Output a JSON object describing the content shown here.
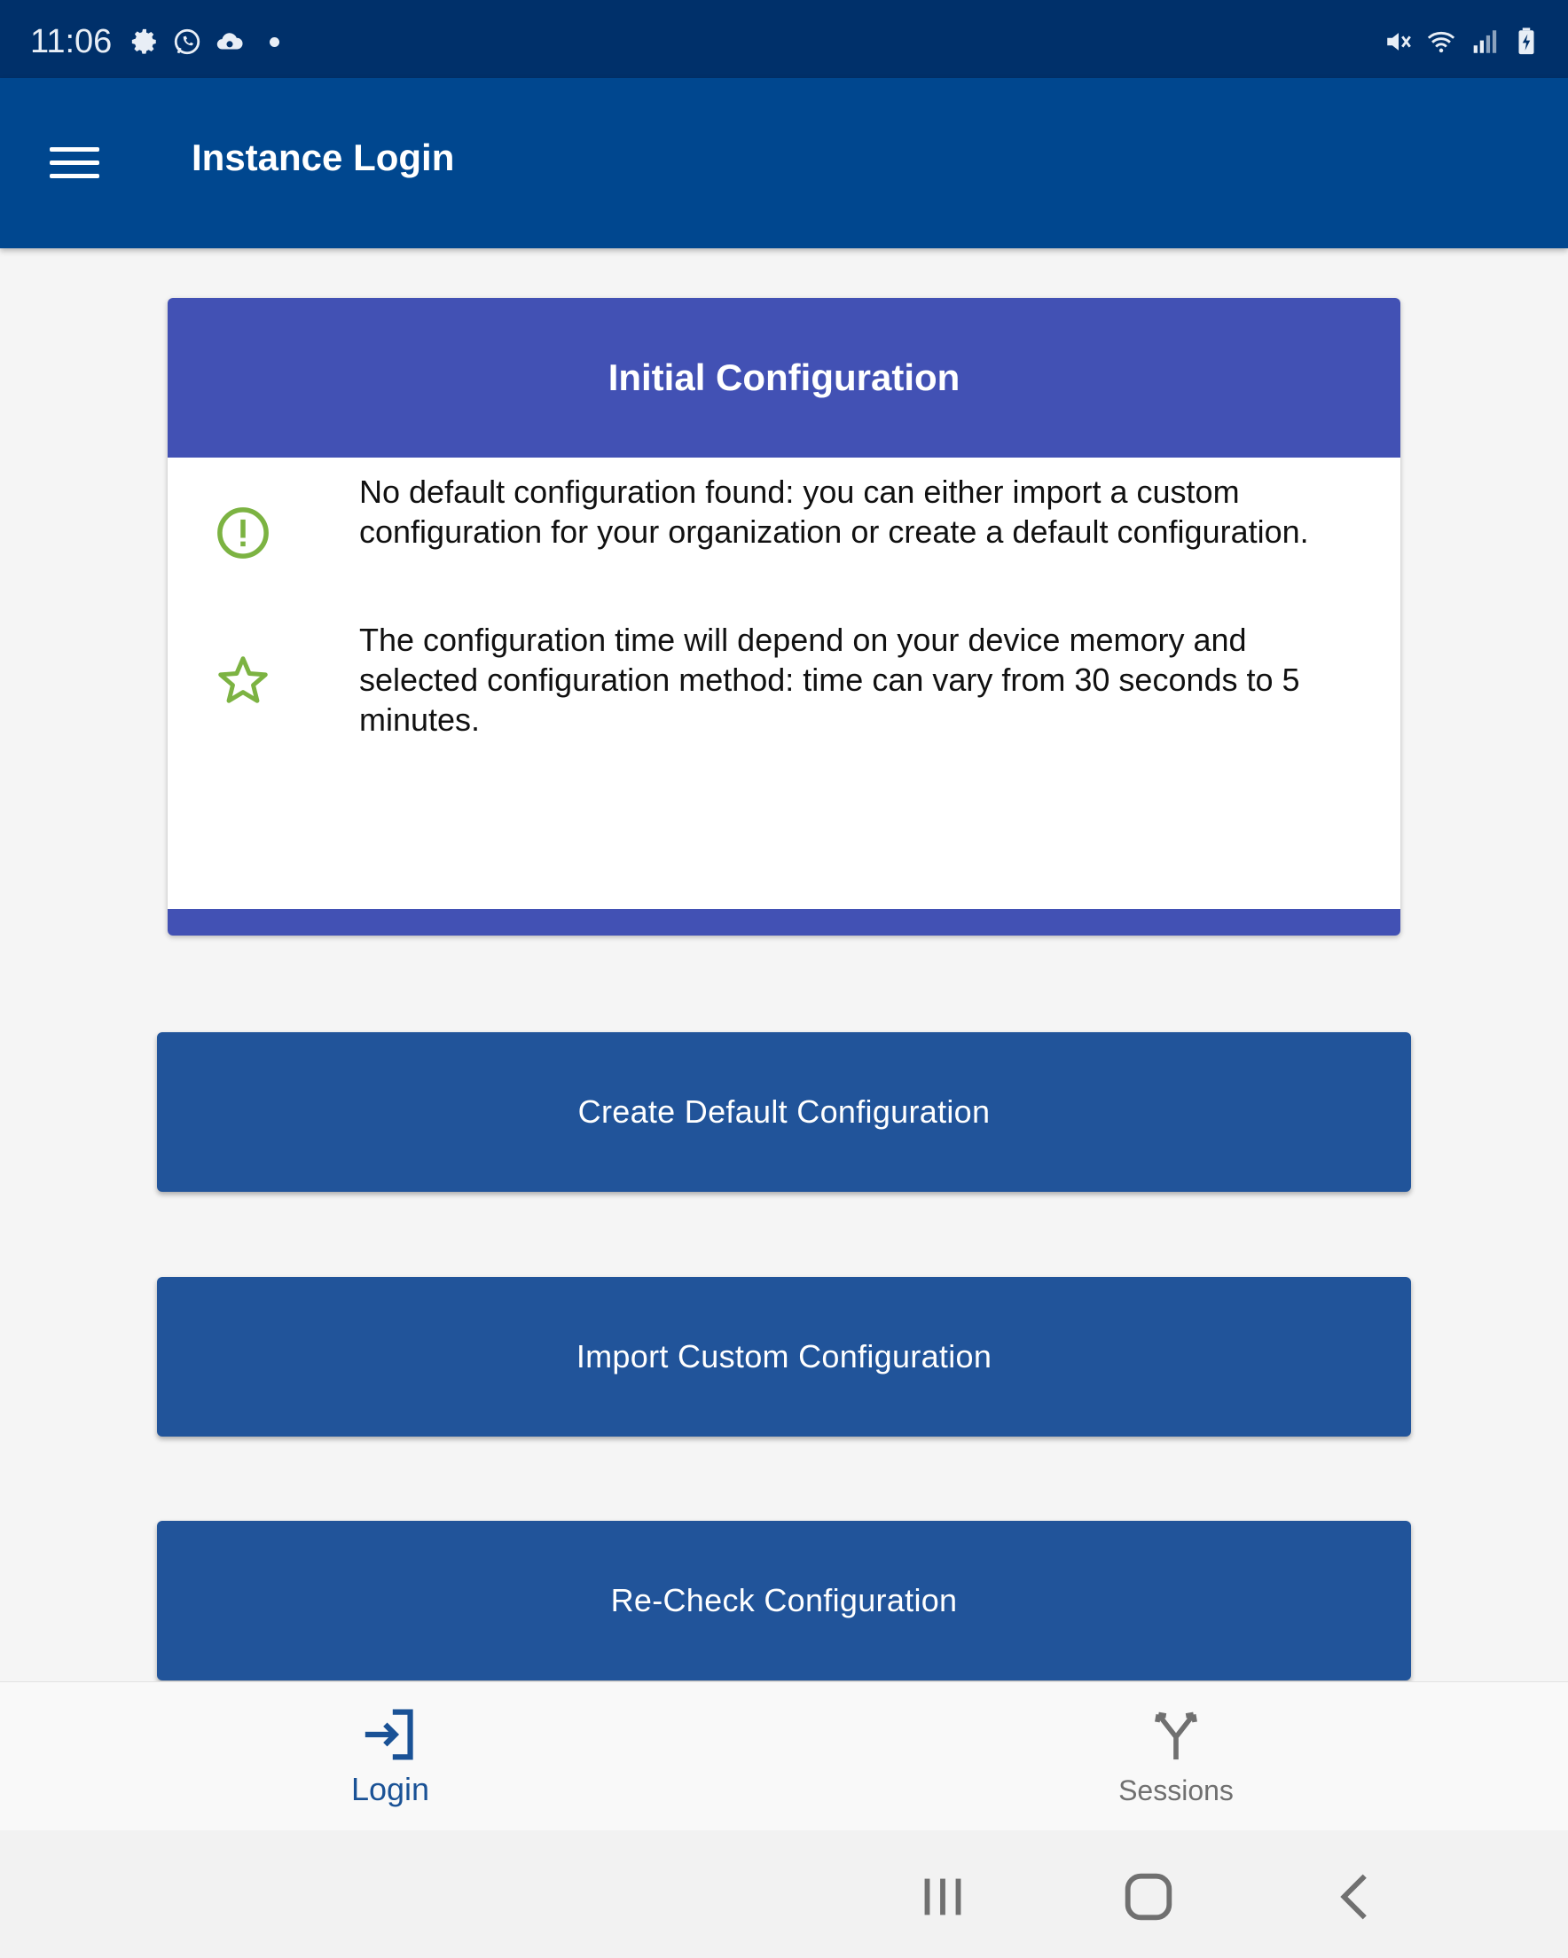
{
  "status_bar": {
    "time": "11:06",
    "left_icons": [
      "settings-icon",
      "whatsapp-icon",
      "cloud-sync-icon",
      "notification-dot-icon"
    ],
    "right_icons": [
      "mute-icon",
      "wifi-icon",
      "signal-icon",
      "battery-charging-icon"
    ]
  },
  "app_bar": {
    "title": "Instance Login",
    "menu_icon": "hamburger-menu-icon"
  },
  "card": {
    "title": "Initial Configuration",
    "items": [
      {
        "icon": "alert-circle-icon",
        "text": "No default configuration found: you can either import a custom configuration for your organization or create a default configuration."
      },
      {
        "icon": "star-outline-icon",
        "text": "The configuration time will depend on your device memory and selected configuration method:  time can vary from 30 seconds to 5 minutes."
      }
    ]
  },
  "buttons": {
    "create_default": "Create Default Configuration",
    "import_custom": "Import Custom Configuration",
    "recheck": "Re-Check Configuration"
  },
  "bottom_nav": {
    "login_label": "Login",
    "sessions_label": "Sessions",
    "active": "Login"
  },
  "colors": {
    "status_bar": "#00306a",
    "app_bar": "#00478f",
    "card_header": "#4251b4",
    "button": "#21549a",
    "icon_green": "#7cb342",
    "nav_active": "#1a5296"
  }
}
